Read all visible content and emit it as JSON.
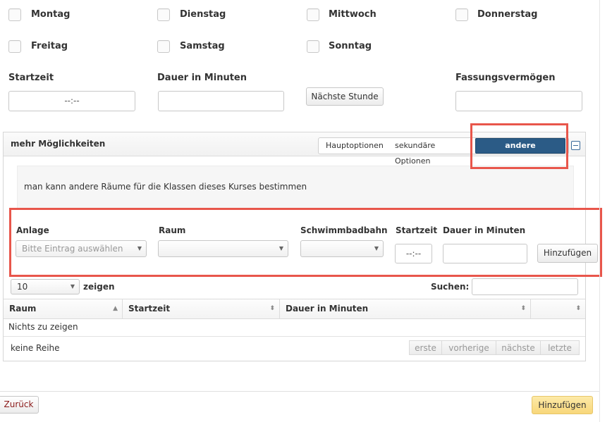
{
  "days": {
    "mon": "Montag",
    "tue": "Dienstag",
    "wed": "Mittwoch",
    "thu": "Donnerstag",
    "fri": "Freitag",
    "sat": "Samstag",
    "sun": "Sonntag"
  },
  "top_form": {
    "start_label": "Startzeit",
    "start_value": "--:--",
    "duration_label": "Dauer in Minuten",
    "duration_value": "",
    "next_hour_button": "Nächste Stunde",
    "capacity_label": "Fassungsvermögen",
    "capacity_value": ""
  },
  "panel": {
    "title": "mehr Möglichkeiten",
    "tabs": [
      "Hauptoptionen",
      "sekundäre Optionen",
      "andere Kollokationen"
    ],
    "active_tab": "andere Kollokationen",
    "info_text": "man kann andere Räume für die Klassen dieses Kurses bestimmen",
    "form": {
      "facility_label": "Anlage",
      "facility_placeholder": "Bitte Eintrag auswählen",
      "room_label": "Raum",
      "room_value": "",
      "lane_label": "Schwimmbadbahn",
      "lane_value": "",
      "start_label": "Startzeit",
      "start_value": "--:--",
      "duration_label": "Dauer in Minuten",
      "duration_value": "",
      "add_button": "Hinzufügen"
    },
    "table": {
      "page_size": "10",
      "show_label": "zeigen",
      "search_label": "Suchen:",
      "search_value": "",
      "columns": [
        "Raum",
        "Startzeit",
        "Dauer in Minuten",
        ""
      ],
      "empty_text": "Nichts zu zeigen",
      "info_text": "keine Reihe",
      "pager": [
        "erste",
        "vorherige",
        "nächste",
        "letzte"
      ]
    }
  },
  "footer": {
    "back_button": "Zurück",
    "add_button": "Hinzufügen"
  },
  "colors": {
    "active_tab": "#2b5b86",
    "highlight": "#e8564b",
    "add_button_bg": "#fbe29a",
    "back_text": "#8b1a1a"
  }
}
